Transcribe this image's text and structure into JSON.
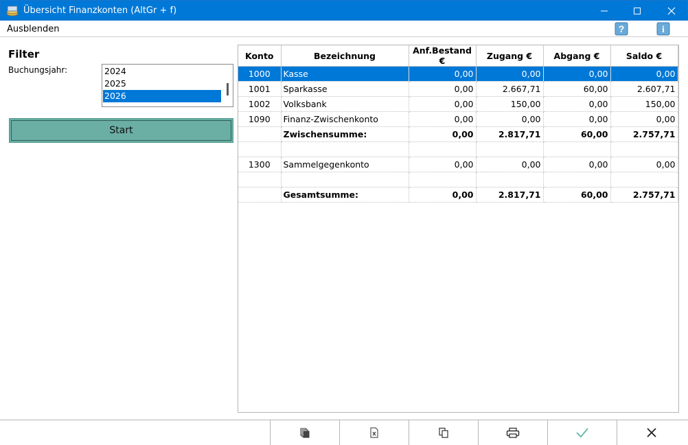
{
  "window": {
    "title": "Übersicht Finanzkonten (AltGr + f)"
  },
  "menubar": {
    "hide_label": "Ausblenden",
    "help_icon": "question-icon",
    "info_icon": "info-icon"
  },
  "filter": {
    "title": "Filter",
    "year_label": "Buchungsjahr:",
    "years": [
      "2024",
      "2025",
      "2026"
    ],
    "selected_year": "2026",
    "start_label": "Start"
  },
  "table": {
    "columns": [
      "Konto",
      "Bezeichnung",
      "Anf.Bestand €",
      "Zugang €",
      "Abgang €",
      "Saldo €"
    ],
    "rows": [
      {
        "konto": "1000",
        "bez": "Kasse",
        "anf": "0,00",
        "zug": "0,00",
        "abg": "0,00",
        "saldo": "0,00"
      },
      {
        "konto": "1001",
        "bez": "Sparkasse",
        "anf": "0,00",
        "zug": "2.667,71",
        "abg": "60,00",
        "saldo": "2.607,71"
      },
      {
        "konto": "1002",
        "bez": "Volksbank",
        "anf": "0,00",
        "zug": "150,00",
        "abg": "0,00",
        "saldo": "150,00"
      },
      {
        "konto": "1090",
        "bez": "Finanz-Zwischenkonto",
        "anf": "0,00",
        "zug": "0,00",
        "abg": "0,00",
        "saldo": "0,00"
      },
      {
        "konto": "",
        "bez": "Zwischensumme:",
        "anf": "0,00",
        "zug": "2.817,71",
        "abg": "60,00",
        "saldo": "2.757,71"
      },
      {
        "konto": "",
        "bez": "",
        "anf": "",
        "zug": "",
        "abg": "",
        "saldo": ""
      },
      {
        "konto": "1300",
        "bez": "Sammelgegenkonto",
        "anf": "0,00",
        "zug": "0,00",
        "abg": "0,00",
        "saldo": "0,00"
      },
      {
        "konto": "",
        "bez": "",
        "anf": "",
        "zug": "",
        "abg": "",
        "saldo": ""
      },
      {
        "konto": "",
        "bez": "Gesamtsumme:",
        "anf": "0,00",
        "zug": "2.817,71",
        "abg": "60,00",
        "saldo": "2.757,71"
      }
    ]
  },
  "bottombar": {
    "buttons": [
      "documents-icon",
      "excel-export-icon",
      "copy-icon",
      "print-icon",
      "checkmark-icon",
      "close-icon"
    ]
  },
  "colors": {
    "titlebar": "#0078d7",
    "selection": "#0078d7",
    "start_button": "#6aaea4",
    "check": "#5fb8a8"
  }
}
